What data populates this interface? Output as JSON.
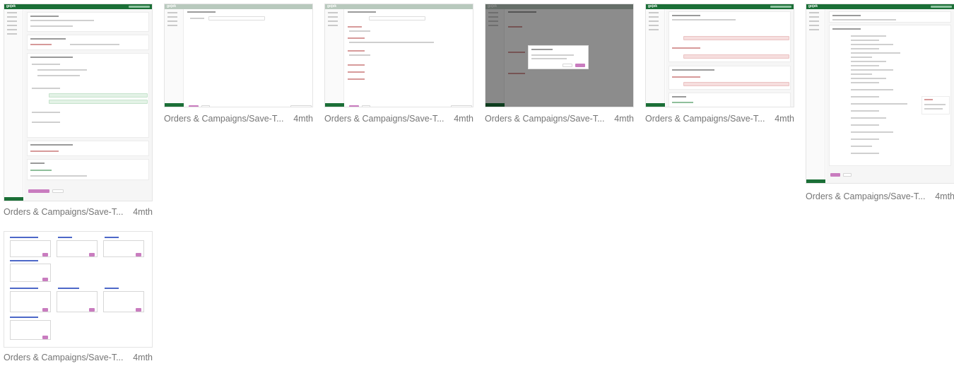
{
  "cards": [
    {
      "caption": "Orders & Campaigns/Save-T...",
      "age": "4mth"
    },
    {
      "caption": "Orders & Campaigns/Save-T...",
      "age": "4mth"
    },
    {
      "caption": "Orders & Campaigns/Save-T...",
      "age": "4mth"
    },
    {
      "caption": "Orders & Campaigns/Save-T...",
      "age": "4mth"
    },
    {
      "caption": "Orders & Campaigns/Save-T...",
      "age": "4mth"
    },
    {
      "caption": "Orders & Campaigns/Save-T...",
      "age": "4mth"
    },
    {
      "caption": "Orders & Campaigns/Save-T...",
      "age": "4mth"
    }
  ],
  "app": {
    "logo": "gojek"
  },
  "colors": {
    "brand": "#1b6f37",
    "accent": "#c97cbf",
    "caption": "#757575"
  }
}
